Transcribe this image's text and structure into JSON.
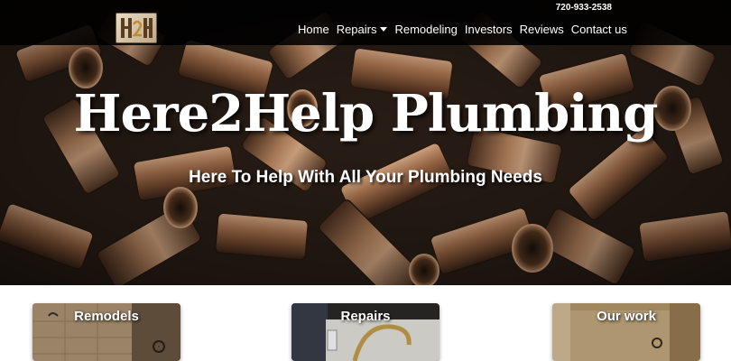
{
  "header": {
    "phone": "720-933-2538",
    "logo_text": "H2H",
    "nav": [
      {
        "label": "Home",
        "has_dropdown": false
      },
      {
        "label": "Repairs",
        "has_dropdown": true,
        "icon": "caret-down-icon"
      },
      {
        "label": "Remodeling",
        "has_dropdown": false
      },
      {
        "label": "Investors",
        "has_dropdown": false
      },
      {
        "label": "Reviews",
        "has_dropdown": false
      },
      {
        "label": "Contact us",
        "has_dropdown": false
      }
    ]
  },
  "hero": {
    "title": "Here2Help Plumbing",
    "subtitle": "Here To Help With All Your Plumbing Needs"
  },
  "cards": [
    {
      "label": "Remodels"
    },
    {
      "label": "Repairs"
    },
    {
      "label": "Our work"
    }
  ],
  "colors": {
    "nav_bg": "#000000",
    "copper": "#b07a52",
    "text": "#ffffff"
  }
}
